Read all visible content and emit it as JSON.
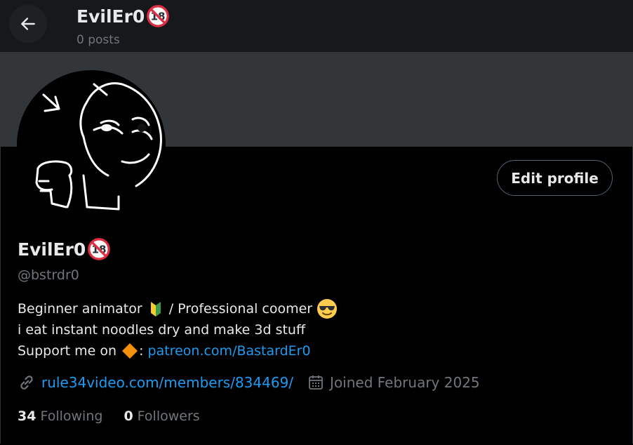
{
  "header": {
    "name": "EvilEr0",
    "posts": "0 posts",
    "badge_icon": "no-one-under-eighteen-icon"
  },
  "banner": {
    "color": "#333639"
  },
  "profile": {
    "edit_label": "Edit profile",
    "display_name": "EvilEr0",
    "handle": "@bstrdr0",
    "bio": {
      "line1_text": "Beginner animator",
      "line1_mid": " / Professional coomer ",
      "line2": "i eat instant noodles dry and make 3d stuff",
      "line3_prefix": "Support me on ",
      "line3_sep": ": ",
      "line3_link": "patreon.com/BastardEr0"
    },
    "website": "rule34video.com/members/834469/",
    "joined": "Joined February 2025",
    "following_count": "34",
    "following_label": "Following",
    "followers_count": "0",
    "followers_label": "Followers"
  },
  "colors": {
    "accent": "#1d9bf0",
    "muted": "#71767b",
    "text": "#e7e9ea"
  }
}
